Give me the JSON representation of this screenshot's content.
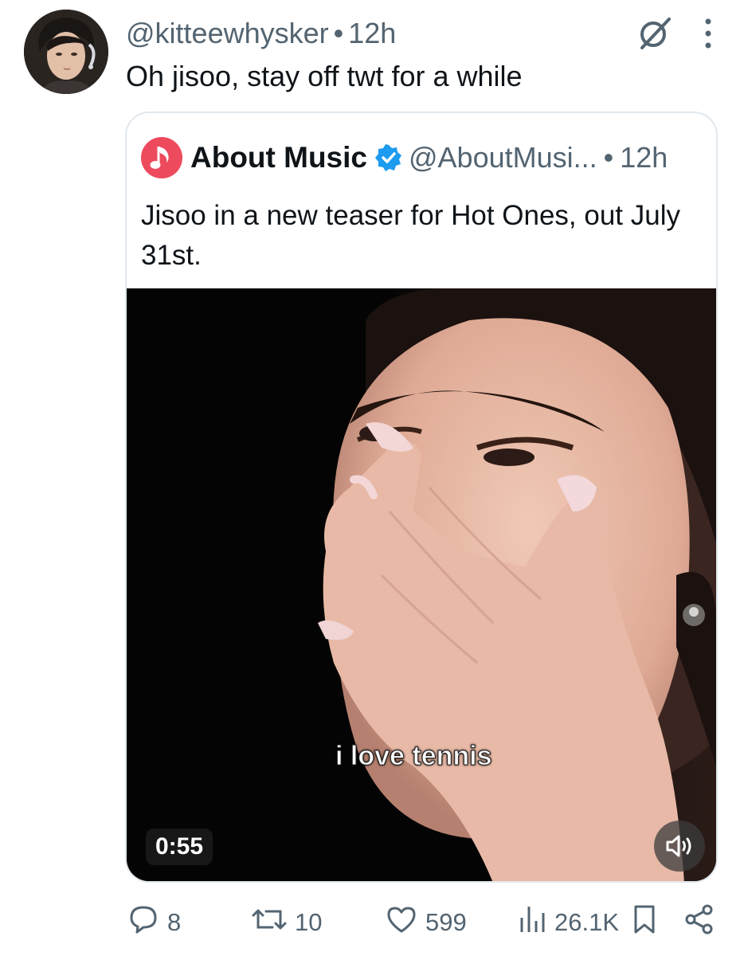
{
  "post": {
    "handle": "@kitteewhysker",
    "separator": "•",
    "time": "12h",
    "text": "Oh jisoo, stay off twt for a while",
    "header_icons": [
      "grok-icon",
      "more-vertical-icon"
    ]
  },
  "quote": {
    "name": "About Music",
    "verified": true,
    "handle": "@AboutMusi...",
    "separator": "•",
    "time": "12h",
    "text": "Jisoo in a new teaser for Hot Ones, out July 31st.",
    "video": {
      "subtitle": "i love tennis",
      "duration": "0:55",
      "sound_icon": "speaker-icon"
    }
  },
  "actions": {
    "replies": "8",
    "reposts": "10",
    "likes": "599",
    "views": "26.1K",
    "bookmark_icon": "bookmark-icon",
    "share_icon": "share-icon"
  },
  "colors": {
    "text": "#0f1419",
    "muted": "#536471",
    "verified_blue": "#1d9bf0",
    "brand_red": "#ee4a5d",
    "card_border": "#e1e8ed"
  }
}
